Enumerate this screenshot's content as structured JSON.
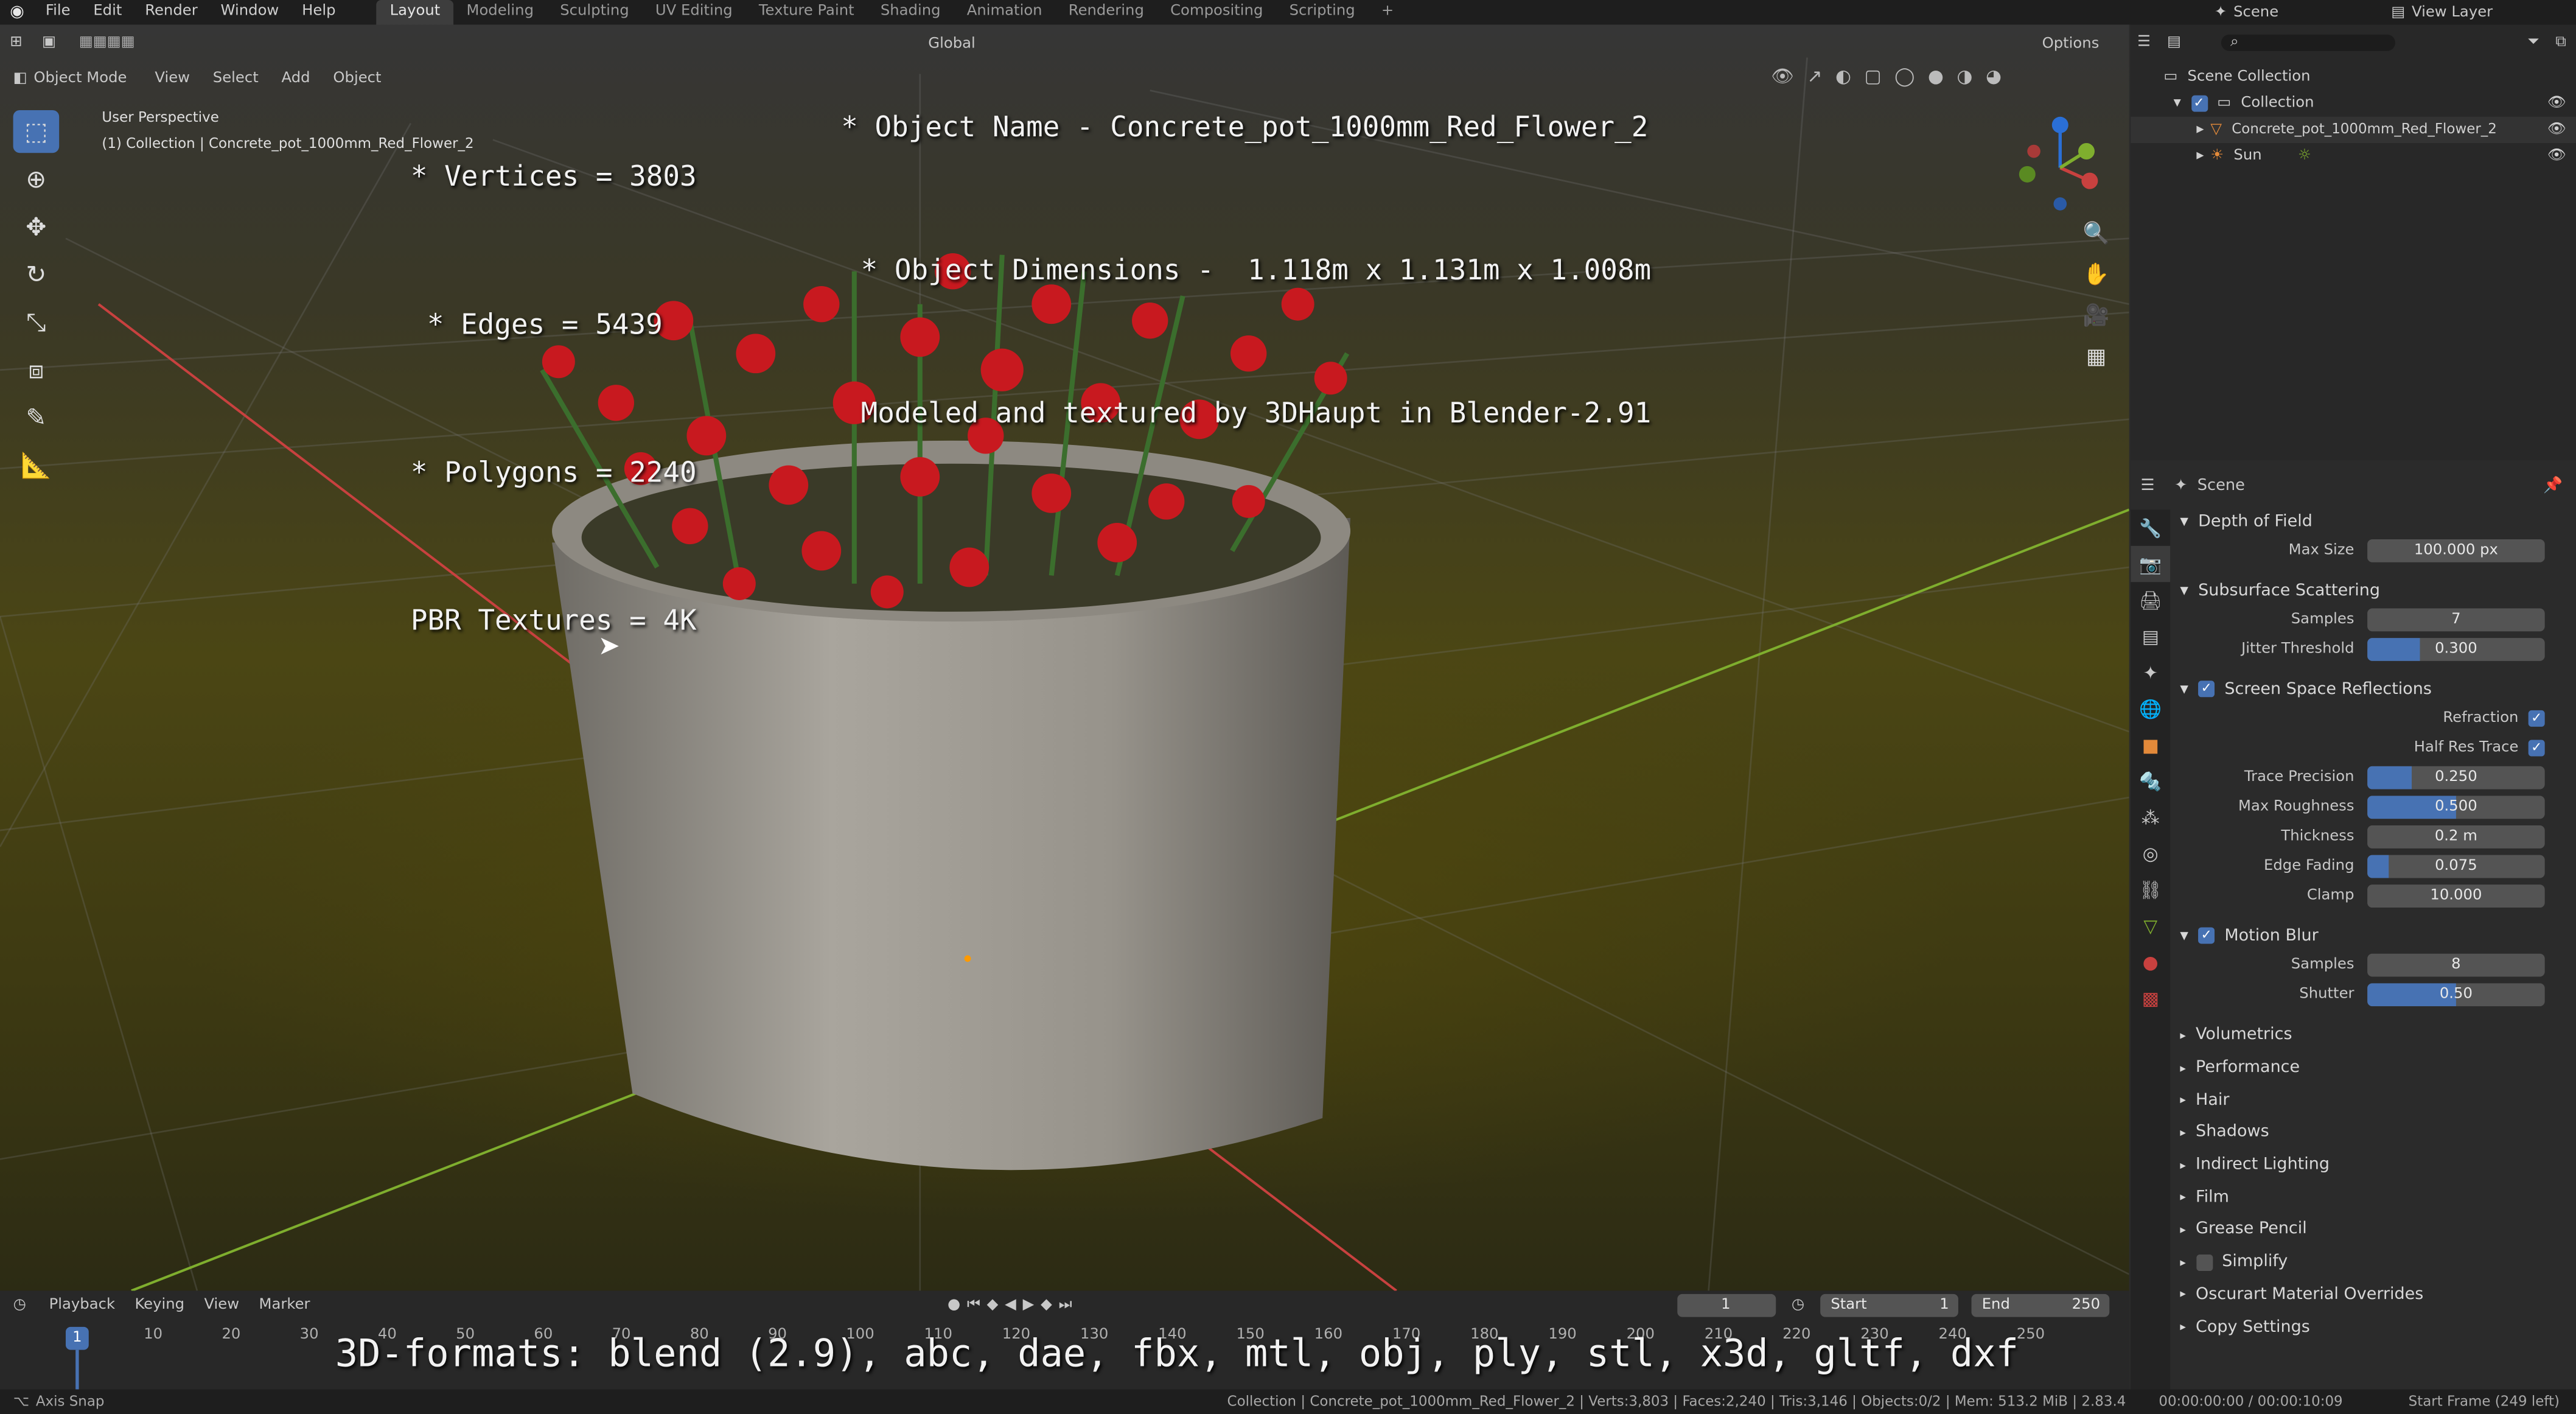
{
  "topbar": {
    "menus": [
      "File",
      "Edit",
      "Render",
      "Window",
      "Help"
    ],
    "workspace_tabs": [
      "Layout",
      "Modeling",
      "Sculpting",
      "UV Editing",
      "Texture Paint",
      "Shading",
      "Animation",
      "Rendering",
      "Compositing",
      "Scripting"
    ],
    "active_tab": "Layout",
    "scene_label": "Scene",
    "view_layer_label": "View Layer"
  },
  "viewport": {
    "mode": "Object Mode",
    "menus": [
      "View",
      "Select",
      "Add",
      "Object"
    ],
    "transform_orientation": "Global",
    "options_label": "Options",
    "perspective_label": "User Perspective",
    "collection_label": "(1) Collection | Concrete_pot_1000mm_Red_Flower_2",
    "overlay_left": [
      "* Vertices = 3803",
      "* Edges = 5439",
      "* Polygons = 2240",
      "PBR Textures = 4K"
    ],
    "overlay_right": [
      "* Object Name - Concrete_pot_1000mm_Red_Flower_2",
      "* Object Dimensions -  1.118m x 1.131m x 1.008m",
      "Modeled and textured by 3DHaupt in Blender-2.91"
    ],
    "bottom_caption": "3D-formats: blend (2.9), abc, dae, fbx, mtl, obj, ply, stl, x3d, gltf, dxf"
  },
  "outliner": {
    "scene_collection": "Scene Collection",
    "collection": "Collection",
    "object": "Concrete_pot_1000mm_Red_Flower_2",
    "sun": "Sun"
  },
  "properties": {
    "context": "Scene",
    "dof": {
      "title": "Depth of Field",
      "max_size_label": "Max Size",
      "max_size": "100.000 px"
    },
    "sss": {
      "title": "Subsurface Scattering",
      "samples_label": "Samples",
      "samples": "7",
      "jitter_label": "Jitter Threshold",
      "jitter": "0.300",
      "jitter_fill": 0.3
    },
    "ssr": {
      "title": "Screen Space Reflections",
      "refraction_label": "Refraction",
      "half_res_label": "Half Res Trace",
      "trace_label": "Trace Precision",
      "trace": "0.250",
      "trace_fill": 0.25,
      "roughness_label": "Max Roughness",
      "roughness": "0.500",
      "roughness_fill": 0.5,
      "thickness_label": "Thickness",
      "thickness": "0.2 m",
      "edge_label": "Edge Fading",
      "edge": "0.075",
      "edge_fill": 0.12,
      "clamp_label": "Clamp",
      "clamp": "10.000"
    },
    "motion_blur": {
      "title": "Motion Blur",
      "samples_label": "Samples",
      "samples": "8",
      "shutter_label": "Shutter",
      "shutter": "0.50",
      "shutter_fill": 0.5
    },
    "collapsed": [
      "Volumetrics",
      "Performance",
      "Hair",
      "Shadows",
      "Indirect Lighting",
      "Film",
      "Grease Pencil",
      "Simplify",
      "Oscurart Material Overrides",
      "Copy Settings"
    ]
  },
  "timeline": {
    "menus": [
      "Playback",
      "Keying",
      "View",
      "Marker"
    ],
    "current_frame": "1",
    "start_label": "Start",
    "start": "1",
    "end_label": "End",
    "end": "250",
    "ticks": [
      "1",
      "10",
      "20",
      "30",
      "40",
      "50",
      "60",
      "70",
      "80",
      "90",
      "100",
      "110",
      "120",
      "130",
      "140",
      "150",
      "160",
      "170",
      "180",
      "190",
      "200",
      "210",
      "220",
      "230",
      "240",
      "250"
    ]
  },
  "statusbar": {
    "left": "Axis Snap",
    "stats": "Collection | Concrete_pot_1000mm_Red_Flower_2 | Verts:3,803 | Faces:2,240 | Tris:3,146 | Objects:0/2 | Mem: 513.2 MiB | 2.83.4",
    "time": "00:00:00:00 / 00:00:10:09",
    "start_frame": "Start Frame (249 left)"
  },
  "colors": {
    "accent": "#4772b3",
    "x_axis": "#c8413f",
    "y_axis": "#7fae2e",
    "pot": "#9e9a92",
    "flower": "#c8191f"
  }
}
